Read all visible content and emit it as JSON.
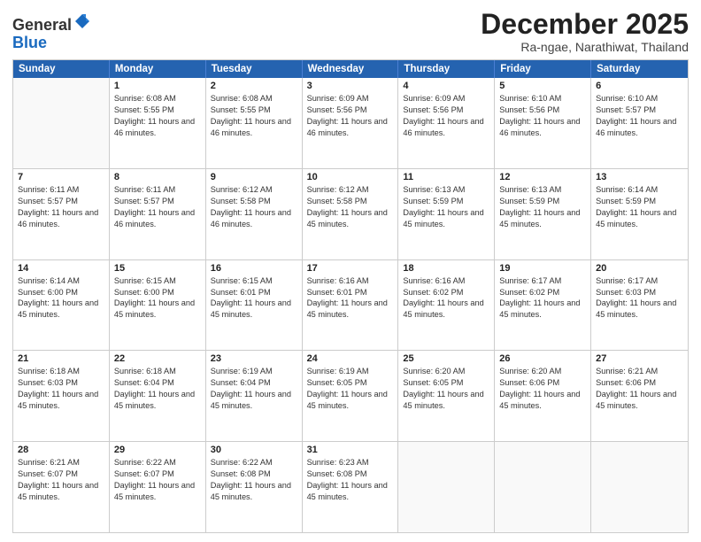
{
  "header": {
    "logo_general": "General",
    "logo_blue": "Blue",
    "month_title": "December 2025",
    "location": "Ra-ngae, Narathiwat, Thailand"
  },
  "days_of_week": [
    "Sunday",
    "Monday",
    "Tuesday",
    "Wednesday",
    "Thursday",
    "Friday",
    "Saturday"
  ],
  "weeks": [
    [
      {
        "day": "",
        "empty": true
      },
      {
        "day": "1",
        "sunrise": "6:08 AM",
        "sunset": "5:55 PM",
        "daylight": "11 hours and 46 minutes."
      },
      {
        "day": "2",
        "sunrise": "6:08 AM",
        "sunset": "5:55 PM",
        "daylight": "11 hours and 46 minutes."
      },
      {
        "day": "3",
        "sunrise": "6:09 AM",
        "sunset": "5:56 PM",
        "daylight": "11 hours and 46 minutes."
      },
      {
        "day": "4",
        "sunrise": "6:09 AM",
        "sunset": "5:56 PM",
        "daylight": "11 hours and 46 minutes."
      },
      {
        "day": "5",
        "sunrise": "6:10 AM",
        "sunset": "5:56 PM",
        "daylight": "11 hours and 46 minutes."
      },
      {
        "day": "6",
        "sunrise": "6:10 AM",
        "sunset": "5:57 PM",
        "daylight": "11 hours and 46 minutes."
      }
    ],
    [
      {
        "day": "7",
        "sunrise": "6:11 AM",
        "sunset": "5:57 PM",
        "daylight": "11 hours and 46 minutes."
      },
      {
        "day": "8",
        "sunrise": "6:11 AM",
        "sunset": "5:57 PM",
        "daylight": "11 hours and 46 minutes."
      },
      {
        "day": "9",
        "sunrise": "6:12 AM",
        "sunset": "5:58 PM",
        "daylight": "11 hours and 46 minutes."
      },
      {
        "day": "10",
        "sunrise": "6:12 AM",
        "sunset": "5:58 PM",
        "daylight": "11 hours and 45 minutes."
      },
      {
        "day": "11",
        "sunrise": "6:13 AM",
        "sunset": "5:59 PM",
        "daylight": "11 hours and 45 minutes."
      },
      {
        "day": "12",
        "sunrise": "6:13 AM",
        "sunset": "5:59 PM",
        "daylight": "11 hours and 45 minutes."
      },
      {
        "day": "13",
        "sunrise": "6:14 AM",
        "sunset": "5:59 PM",
        "daylight": "11 hours and 45 minutes."
      }
    ],
    [
      {
        "day": "14",
        "sunrise": "6:14 AM",
        "sunset": "6:00 PM",
        "daylight": "11 hours and 45 minutes."
      },
      {
        "day": "15",
        "sunrise": "6:15 AM",
        "sunset": "6:00 PM",
        "daylight": "11 hours and 45 minutes."
      },
      {
        "day": "16",
        "sunrise": "6:15 AM",
        "sunset": "6:01 PM",
        "daylight": "11 hours and 45 minutes."
      },
      {
        "day": "17",
        "sunrise": "6:16 AM",
        "sunset": "6:01 PM",
        "daylight": "11 hours and 45 minutes."
      },
      {
        "day": "18",
        "sunrise": "6:16 AM",
        "sunset": "6:02 PM",
        "daylight": "11 hours and 45 minutes."
      },
      {
        "day": "19",
        "sunrise": "6:17 AM",
        "sunset": "6:02 PM",
        "daylight": "11 hours and 45 minutes."
      },
      {
        "day": "20",
        "sunrise": "6:17 AM",
        "sunset": "6:03 PM",
        "daylight": "11 hours and 45 minutes."
      }
    ],
    [
      {
        "day": "21",
        "sunrise": "6:18 AM",
        "sunset": "6:03 PM",
        "daylight": "11 hours and 45 minutes."
      },
      {
        "day": "22",
        "sunrise": "6:18 AM",
        "sunset": "6:04 PM",
        "daylight": "11 hours and 45 minutes."
      },
      {
        "day": "23",
        "sunrise": "6:19 AM",
        "sunset": "6:04 PM",
        "daylight": "11 hours and 45 minutes."
      },
      {
        "day": "24",
        "sunrise": "6:19 AM",
        "sunset": "6:05 PM",
        "daylight": "11 hours and 45 minutes."
      },
      {
        "day": "25",
        "sunrise": "6:20 AM",
        "sunset": "6:05 PM",
        "daylight": "11 hours and 45 minutes."
      },
      {
        "day": "26",
        "sunrise": "6:20 AM",
        "sunset": "6:06 PM",
        "daylight": "11 hours and 45 minutes."
      },
      {
        "day": "27",
        "sunrise": "6:21 AM",
        "sunset": "6:06 PM",
        "daylight": "11 hours and 45 minutes."
      }
    ],
    [
      {
        "day": "28",
        "sunrise": "6:21 AM",
        "sunset": "6:07 PM",
        "daylight": "11 hours and 45 minutes."
      },
      {
        "day": "29",
        "sunrise": "6:22 AM",
        "sunset": "6:07 PM",
        "daylight": "11 hours and 45 minutes."
      },
      {
        "day": "30",
        "sunrise": "6:22 AM",
        "sunset": "6:08 PM",
        "daylight": "11 hours and 45 minutes."
      },
      {
        "day": "31",
        "sunrise": "6:23 AM",
        "sunset": "6:08 PM",
        "daylight": "11 hours and 45 minutes."
      },
      {
        "day": "",
        "empty": true
      },
      {
        "day": "",
        "empty": true
      },
      {
        "day": "",
        "empty": true
      }
    ]
  ]
}
